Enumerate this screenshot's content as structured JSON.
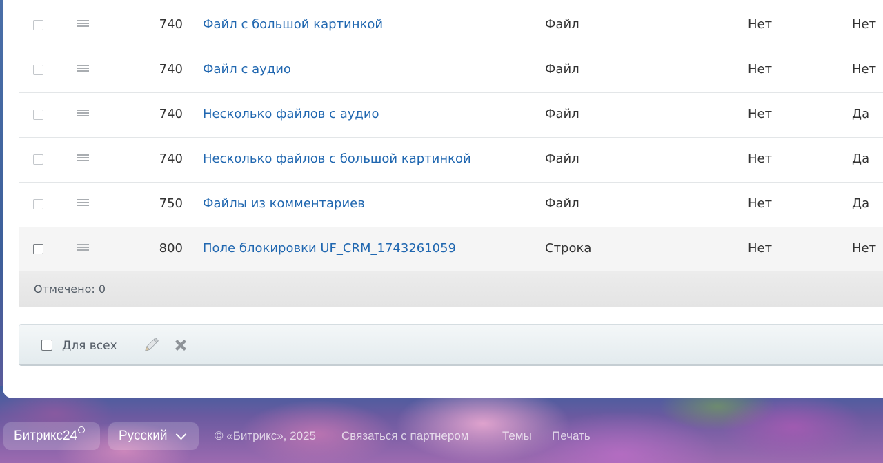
{
  "rows": [
    {
      "num": "740",
      "name": "Файл с большой картинкой",
      "type": "Файл",
      "col1": "Нет",
      "col2": "Нет"
    },
    {
      "num": "740",
      "name": "Файл с аудио",
      "type": "Файл",
      "col1": "Нет",
      "col2": "Нет"
    },
    {
      "num": "740",
      "name": "Несколько файлов с аудио",
      "type": "Файл",
      "col1": "Нет",
      "col2": "Да"
    },
    {
      "num": "740",
      "name": "Несколько файлов с большой картинкой",
      "type": "Файл",
      "col1": "Нет",
      "col2": "Да"
    },
    {
      "num": "750",
      "name": "Файлы из комментариев",
      "type": "Файл",
      "col1": "Нет",
      "col2": "Да"
    },
    {
      "num": "800",
      "name": "Поле блокировки UF_CRM_1743261059",
      "type": "Строка",
      "col1": "Нет",
      "col2": "Нет"
    }
  ],
  "counter": {
    "label": "Отмечено: 0"
  },
  "actions": {
    "for_all_label": "Для всех",
    "edit_icon": "pencil-icon",
    "delete_icon": "close-x-icon"
  },
  "footer": {
    "brand": "Битрикс24",
    "language": "Русский",
    "copyright": "© «Битрикс», 2025",
    "links": [
      "Связаться с партнером",
      "Темы",
      "Печать"
    ]
  },
  "colors": {
    "link": "#2067b0",
    "text": "#333333"
  }
}
